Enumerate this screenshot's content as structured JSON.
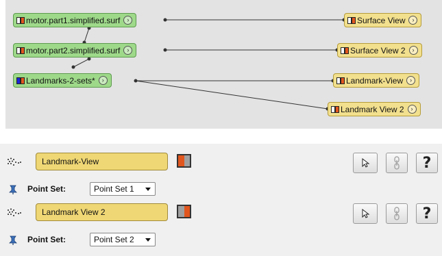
{
  "pool": {
    "data_nodes": [
      {
        "label": "motor.part1.simplified.surf",
        "swatch": [
          "w",
          "o"
        ]
      },
      {
        "label": "motor.part2.simplified.surf",
        "swatch": [
          "w",
          "o"
        ]
      },
      {
        "label": "Landmarks-2-sets*",
        "swatch": [
          "b",
          "o"
        ]
      }
    ],
    "module_nodes": [
      {
        "label": "Surface View",
        "swatch": [
          "w",
          "o"
        ]
      },
      {
        "label": "Surface View 2",
        "swatch": [
          "w",
          "o"
        ]
      },
      {
        "label": "Landmark-View",
        "swatch": [
          "w",
          "o"
        ]
      },
      {
        "label": "Landmark View 2",
        "swatch": [
          "w",
          "o"
        ]
      }
    ],
    "node_button_glyph": "›"
  },
  "properties": {
    "modules": [
      {
        "icon": "point-set-icon",
        "name": "Landmark-View",
        "port_label": "Point Set:",
        "port_value": "Point Set 1"
      },
      {
        "icon": "point-set-icon",
        "name": "Landmark View 2",
        "port_label": "Point Set:",
        "port_value": "Point Set 2"
      }
    ],
    "help_label": "?"
  },
  "colors": {
    "data_node": "#9ed98a",
    "module_node": "#f2e08e",
    "pool_background": "#e3e3e3",
    "orange": "#e1561e",
    "blue": "#1a28d8"
  }
}
